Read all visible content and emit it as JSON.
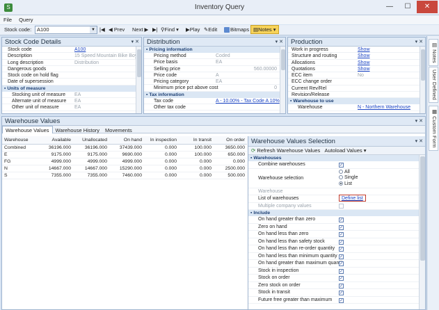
{
  "window": {
    "title": "Inventory Query",
    "min": "—",
    "max": "☐",
    "close": "✕"
  },
  "menu": [
    "File",
    "Query"
  ],
  "toolbar": {
    "stock_label": "Stock code:",
    "stock_value": "A100",
    "prev": "Prev",
    "next": "Next",
    "find": "Find",
    "play": "Play",
    "edit": "Edit",
    "bitmaps": "Bitmaps",
    "notes": "Notes"
  },
  "stock_details": {
    "title": "Stock Code Details",
    "rows": [
      {
        "label": "Stock code",
        "value": "A100",
        "link": true
      },
      {
        "label": "Description",
        "value": "15 Speed Mountain Bike Boys"
      },
      {
        "label": "Long description",
        "value": "Distribution"
      },
      {
        "label": "Dangerous goods",
        "value": ""
      },
      {
        "label": "Stock code on hold flag",
        "value": ""
      },
      {
        "label": "Date of supersession",
        "value": ""
      }
    ],
    "units_title": "Units of measure",
    "unit_rows": [
      {
        "label": "Stocking unit of measure",
        "value": "EA"
      },
      {
        "label": "Alternate unit of measure",
        "value": "EA"
      },
      {
        "label": "Other unit of measure",
        "value": "EA"
      }
    ]
  },
  "distribution": {
    "title": "Distribution",
    "pricing_title": "Pricing information",
    "pricing_rows": [
      {
        "label": "Pricing method",
        "value": "Coded"
      },
      {
        "label": "Price basis",
        "value": "EA"
      },
      {
        "label": "Selling price",
        "value": "560.00000",
        "num": true
      },
      {
        "label": "Price code",
        "value": "A"
      },
      {
        "label": "Pricing category",
        "value": "EA"
      },
      {
        "label": "Minimum price pct above cost",
        "value": "0",
        "num": true
      }
    ],
    "tax_title": "Tax information",
    "tax_rows": [
      {
        "label": "Tax code",
        "value": "A - 10.00% - Tax Code A 10%",
        "link": true
      },
      {
        "label": "Other tax code",
        "value": ""
      }
    ]
  },
  "production": {
    "title": "Production",
    "rows": [
      {
        "label": "Work in progress",
        "value": "Show",
        "link": true
      },
      {
        "label": "Structure and routing",
        "value": "Show",
        "link": true
      },
      {
        "label": "Allocations",
        "value": "Show",
        "link": true
      },
      {
        "label": "Quotations",
        "value": "Show",
        "link": true
      },
      {
        "label": "ECC item",
        "value": "No"
      },
      {
        "label": "ECC change order",
        "value": ""
      },
      {
        "label": "Current Rev/Rel",
        "value": ""
      },
      {
        "label": "Revision/Release",
        "value": ""
      }
    ],
    "wtu_title": "Warehouse to use",
    "wtu_rows": [
      {
        "label": "Warehouse",
        "value": "N - Northern Warehouse",
        "link": true
      }
    ]
  },
  "warehouse_values": {
    "title": "Warehouse Values",
    "tabs": [
      "Warehouse Values",
      "Warehouse History",
      "Movements"
    ],
    "columns": [
      "Warehouse",
      "Available",
      "Unallocated",
      "On hand",
      "In inspection",
      "In transit",
      "On order"
    ],
    "rows": [
      [
        "Combined",
        "36196.000",
        "36196.000",
        "37439.000",
        "0.000",
        "100.000",
        "3650.000"
      ],
      [
        "E",
        "9175.000",
        "9175.000",
        "9690.000",
        "0.000",
        "100.000",
        "650.000"
      ],
      [
        "FG",
        "4999.000",
        "4999.000",
        "4999.000",
        "0.000",
        "0.000",
        "0.000"
      ],
      [
        "N",
        "14667.000",
        "14667.000",
        "15290.000",
        "0.000",
        "0.000",
        "2500.000"
      ],
      [
        "S",
        "7355.000",
        "7355.000",
        "7460.000",
        "0.000",
        "0.000",
        "500.000"
      ]
    ]
  },
  "selection": {
    "title": "Warehouse Values Selection",
    "refresh": "Refresh Warehouse Values",
    "autoload": "Autoload Values",
    "warehouses_title": "Warehouses",
    "combine_label": "Combine warehouses",
    "wsel_label": "Warehouse selection",
    "wsel_options": [
      "All",
      "Single",
      "List"
    ],
    "warehouse_label": "Warehouse",
    "list_label": "List of warehouses",
    "list_link": "Define list",
    "multi_label": "Multiple company values",
    "include_title": "Include",
    "include_rows": [
      "On hand greater than zero",
      "Zero on hand",
      "On hand less than zero",
      "On hand less than safety stock",
      "On hand less than re-order quantity",
      "On hand less than minimum quantity",
      "On hand greater than maximum quantit",
      "Stock in inspection",
      "Stock on order",
      "Zero stock on order",
      "Stock in transit",
      "Future free greater than maximum"
    ]
  },
  "sidetabs": [
    "Notes",
    "User Defined",
    "Custom Form"
  ],
  "colors": {
    "accent": "#1a44c4",
    "header_bg": "#dfe9f5",
    "notes_highlight": "#f7d35a",
    "highlight_border": "#c0392b"
  }
}
